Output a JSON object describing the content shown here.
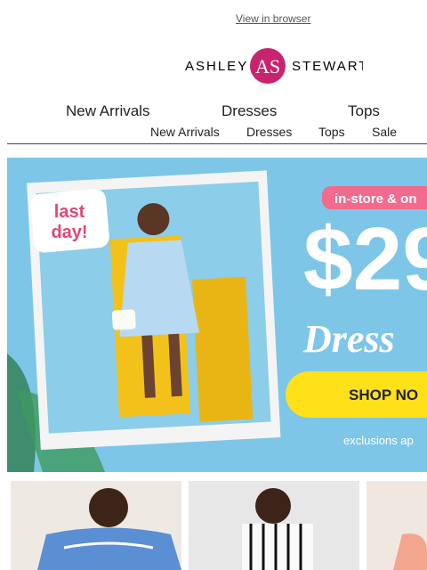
{
  "header": {
    "view_in_browser": "View in browser"
  },
  "logo": {
    "left": "ASHLEY",
    "right": "STEWART",
    "monogram": "AS",
    "brand_color": "#c8246e"
  },
  "nav_primary": [
    {
      "label": "New Arrivals"
    },
    {
      "label": "Dresses"
    },
    {
      "label": "Tops"
    }
  ],
  "nav_secondary": [
    {
      "label": "New Arrivals"
    },
    {
      "label": "Dresses"
    },
    {
      "label": "Tops"
    },
    {
      "label": "Sale"
    }
  ],
  "hero": {
    "badge": "last day!",
    "tag": "in-store & on",
    "price": "$29",
    "headline": "Dress",
    "cta": "SHOP NO",
    "disclaimer": "exclusions ap",
    "colors": {
      "bg": "#7ec6e8",
      "accent": "#f26a8d",
      "cta": "#ffe11a"
    }
  },
  "tiles": [
    {
      "name": "blue-off-shoulder-dress"
    },
    {
      "name": "striped-dress"
    },
    {
      "name": "pink-outfit"
    }
  ]
}
